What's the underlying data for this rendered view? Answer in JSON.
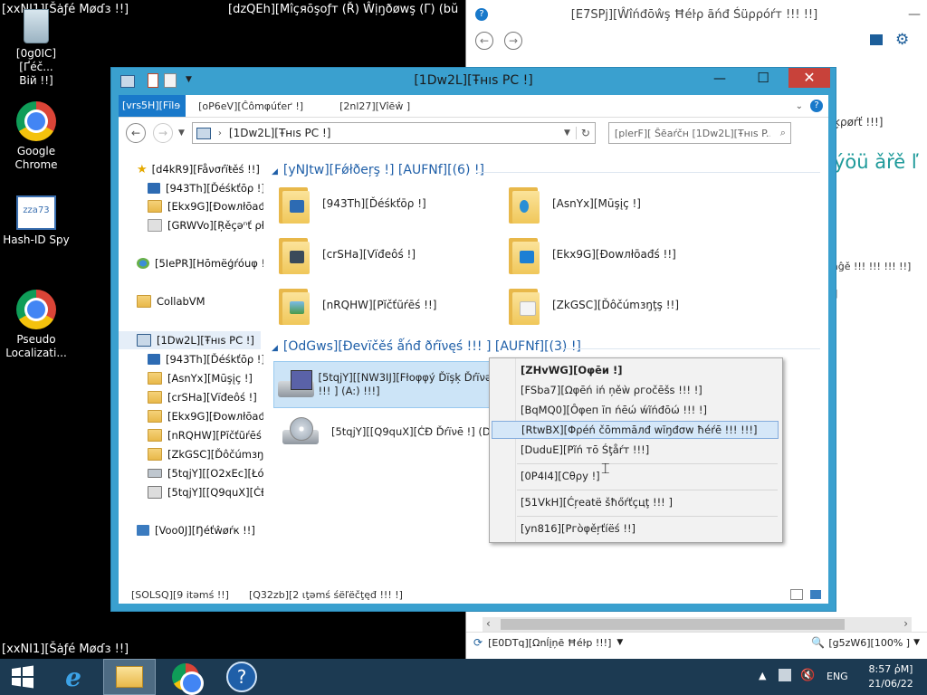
{
  "desktop": {
    "top_left_text": "[xxNI1][Šȧƒé Møɗɜ !!]",
    "bottom_left_text": "[xxNI1][Šȧƒé Møɗɜ !!]",
    "top_title_text": "[dzQEh][Mîçяōşoƒт (Ř) Ŵịŋðøwş (Γ) (bŭ",
    "icons": {
      "recycle": "[0g0IC][Ґéč...\nВій !!]",
      "recycle_l1": "[0g0IC][Ґéč...",
      "recycle_l2": "Вій !!]",
      "chrome_l1": "Google",
      "chrome_l2": "Chrome",
      "hashid": "Hash-ID Spy",
      "pseudo_l1": "Pseudo",
      "pseudo_l2": "Localizati..."
    }
  },
  "help_window": {
    "title": "[E7SPj][Ŵîńđōŵş Ħéŀρ ãńđ Śüρρóŕт !!! !!]",
    "partial_texts": [
      "ķρøŕť !!!]",
      "ýöü ǎřě ľ",
      "āĝě !!! !!! !!! !!]",
      "]"
    ],
    "status_left": "[E0DTq][Ωnĺįņē Ħéŀp !!!]",
    "zoom": "[g5zW6][100% ]"
  },
  "explorer": {
    "title": "[1Dw2L][Ŧнıѕ PC !]",
    "ribbon_tabs": [
      "[vrs5H][Fīlɘ",
      "[oP6eV][Ĉômφúťеґ !]",
      "[2nl27][Vîēŵ ]"
    ],
    "address": "[1Dw2L][Ŧнıѕ PC !]",
    "search_placeholder": "[plerF][ Ŝēaŕčн [1Dw2L][Ŧнıѕ P...",
    "nav_items": [
      "[d4kR9][Fåνσŕïŧěś !!]",
      "[943Th][Ďéśkťōρ !]",
      "[Ekx9G][Ðоwлłōаđś",
      "[GRWVo][Ŗěçəⁿť ρłα",
      "[5IePR][Нōmëģŕóuφ !!",
      "CollabVM",
      "[1Dw2L][Ŧнıѕ PC !]",
      "[943Th][Ďéśkťōρ !]",
      "[AsnYx][Mūşįç !]",
      "[crSHa][Vïđеôś !]",
      "[Ekx9G][Ðоwлłōаđś",
      "[nRQHW][Pĭčťũŕēś !",
      "[ZkGSC][Ďôčúmзŋţş",
      "[5tqjY][[O2xEc][Łóċα",
      "[5tqjY][[Q9quX][ĊĐ",
      "[Voo0J][Ŋéťŵøŕк !!]"
    ],
    "folders_header": "[yNJtw][Fǿłðeŗş !] [AUFNf][(6) !]",
    "folders": [
      "[943Th][Ďéśkťōρ !]",
      "[AsnYx][Mūşįç !]",
      "[crSHa][Vïđеôś !]",
      "[Ekx9G][Ðоwлłōаđś !!]",
      "[nRQHW][Pĭčťũŕēś !!]",
      "[ZkGSC][Ďôčúmзŋţş !!]"
    ],
    "devices_header": "[OdGws][Ðеvïčěś ǻńđ ðŕĭνęś !!! ] [AUFNf][(3) !]",
    "devices": [
      {
        "line1": "[5tqjY][[NW3IJ][Fłoφφý Ďïşķ Ďŕïνə",
        "line2": "!!! ] (A:) !!!]"
      },
      {
        "line1": "[5tqjY][[Q9quX][ĊĐ Ďŕïνē !] (D:) !!!]",
        "line2": ""
      }
    ],
    "status_items": "[SOLSQ][9 itəmś !!]",
    "status_selected": "[Q32zb][2 ɩţəmś śёľёčţęđ !!! !]"
  },
  "context_menu": {
    "items": [
      "[ZHvWG][Oφēи !]",
      "[FSba7][Ωφēń іń ņěẁ ρгоčēšs !!! !]",
      "[BqMQ0][Ôφеп ĭп ńēώ ẃĩńđōώ !!! !]",
      "[RtwBX][Φρéń čōmmāлđ wĭŋđσw ħéŕē !!! !!!]",
      "[DuduE][Ρĩń тō Śţåŕт !!!]",
      "[0P4I4][Сθρу !]",
      "[51VkH][Ćŗеаtë šħőŕťçцţ !!! ]",
      "[yn816][Ρгòφěŗťíёś !!]"
    ]
  },
  "taskbar": {
    "lang": "ENG",
    "time": "8:57 ῤM]",
    "date": "21/06/22"
  }
}
